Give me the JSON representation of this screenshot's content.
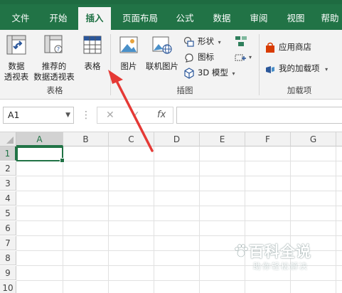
{
  "tabs": [
    {
      "label": "文件",
      "active": false
    },
    {
      "label": "开始",
      "active": false
    },
    {
      "label": "插入",
      "active": true
    },
    {
      "label": "页面布局",
      "active": false
    },
    {
      "label": "公式",
      "active": false
    },
    {
      "label": "数据",
      "active": false
    },
    {
      "label": "审阅",
      "active": false
    },
    {
      "label": "视图",
      "active": false
    },
    {
      "label": "帮助",
      "active": false
    }
  ],
  "ribbon": {
    "tables_group": {
      "label": "表格",
      "pivot_line1": "数据",
      "pivot_line2": "透视表",
      "recommended_line1": "推荐的",
      "recommended_line2": "数据透视表",
      "table": "表格"
    },
    "illustrations_group": {
      "label": "插图",
      "pictures": "图片",
      "online_pictures": "联机图片",
      "shapes": "形状",
      "icons": "图标",
      "models_3d": "3D 模型"
    },
    "addins_group": {
      "label": "加载项",
      "store": "应用商店",
      "my_addins": "我的加载项"
    }
  },
  "formula_bar": {
    "name_box": "A1",
    "cancel_symbol": "✕",
    "enter_symbol": "✓",
    "fx_symbol": "fx",
    "formula_value": ""
  },
  "grid": {
    "columns": [
      "A",
      "B",
      "C",
      "D",
      "E",
      "F",
      "G"
    ],
    "rows": [
      "1",
      "2",
      "3",
      "4",
      "5",
      "6",
      "7",
      "8",
      "9",
      "10"
    ],
    "active_cell": "A1"
  },
  "watermark": {
    "title": "百科全说",
    "subtitle": "助你轻松解决"
  },
  "colors": {
    "excel_green": "#217346",
    "arrow_red": "#e53935"
  }
}
